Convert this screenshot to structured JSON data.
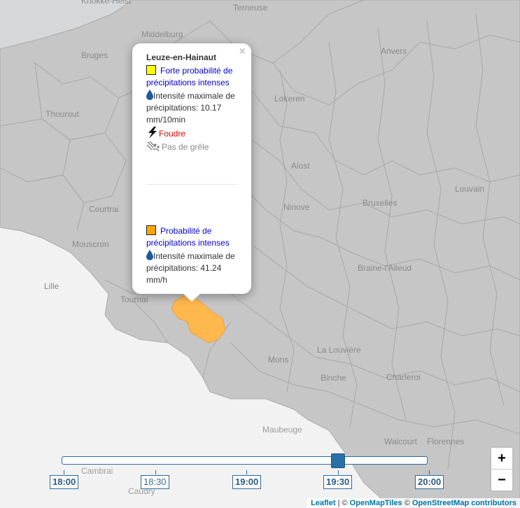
{
  "places": {
    "terneuse": "Terneuse",
    "middelburg": "Middelburg",
    "bruges": "Bruges",
    "anvers": "Anvers",
    "thourout": "Thourout",
    "lokeren": "Lokeren",
    "alost": "Alost",
    "louvain": "Louvain",
    "courtrai": "Courtrai",
    "ninove": "Ninove",
    "bruxelles": "Bruxelles",
    "mouscron": "Mouscron",
    "braine": "Braine-l'Alleud",
    "lille": "Lille",
    "tournai": "Tournai",
    "la_louviere": "La Louvière",
    "mons": "Mons",
    "binche": "Binche",
    "charleroi": "Charleroi",
    "maubeuge": "Maubeuge",
    "walcourt": "Walcourt",
    "florennes": "Florennes",
    "cambrai": "Cambrai",
    "caudry": "Caudry",
    "knokke": "Knokke-Heist"
  },
  "popup": {
    "title": "Leuze-en-Hainaut",
    "close": "×",
    "warn1": "Forte probabilité de précipitations intenses",
    "warn1_color": "#ffff00",
    "intensity1": "Intensité maximale de précipitations: 10.17 mm/10min",
    "lightning": "Foudre",
    "hail": "Pas de grêle",
    "warn2": "Probabilité de précipitations intenses",
    "warn2_color": "#ffa500",
    "intensity2": "Intensité maximale de précipitations: 41.24 mm/h"
  },
  "timeline": {
    "labels": [
      "18:00",
      "18:30",
      "19:00",
      "19:30",
      "20:00"
    ],
    "selected_index": 3,
    "position_fraction": 0.75
  },
  "zoom": {
    "in": "+",
    "out": "−"
  },
  "attribution": {
    "leaflet": "Leaflet",
    "sep": " | © ",
    "omt": "OpenMapTiles",
    "mid": " © ",
    "osm": "OpenStreetMap contributors"
  },
  "colors": {
    "belgium": "#c6c6c6",
    "borders": "#a5a5a5",
    "warning_area": "#ffb84d",
    "sea": "#d4d7da"
  }
}
